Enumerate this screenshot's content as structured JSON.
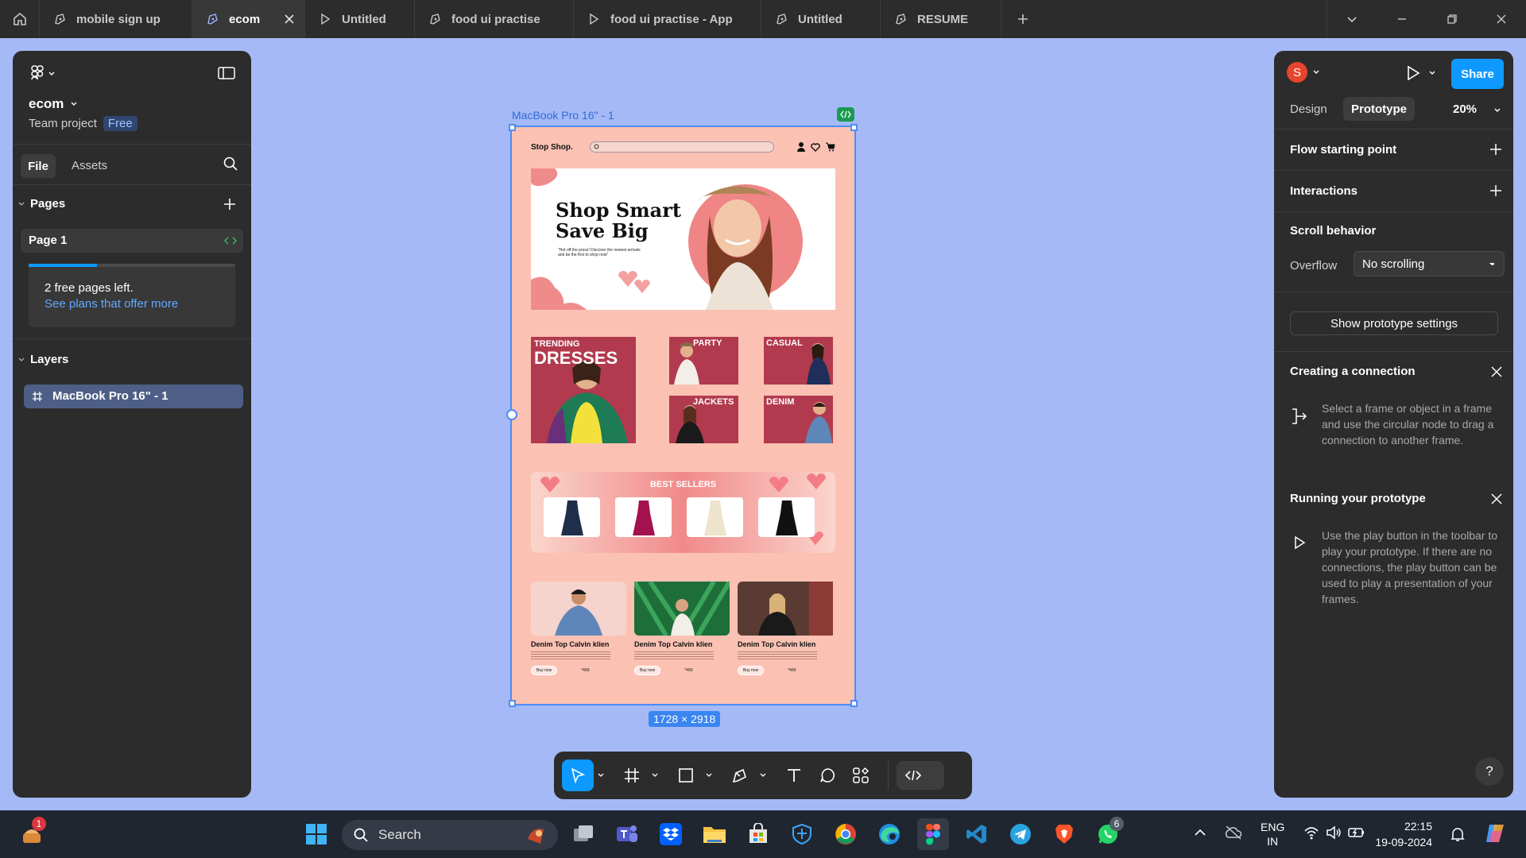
{
  "tabs": [
    {
      "label": "mobile sign up",
      "icon": "figma-file-icon"
    },
    {
      "label": "ecom",
      "icon": "figma-file-icon",
      "active": true
    },
    {
      "label": "Untitled",
      "icon": "play-icon"
    },
    {
      "label": "food ui practise",
      "icon": "figma-file-icon"
    },
    {
      "label": "food ui practise - App",
      "icon": "play-icon"
    },
    {
      "label": "Untitled",
      "icon": "figma-file-icon"
    },
    {
      "label": "RESUME",
      "icon": "figma-file-icon"
    }
  ],
  "left": {
    "project": "ecom",
    "team": "Team project",
    "plan_badge": "Free",
    "tab_file": "File",
    "tab_assets": "Assets",
    "pages_title": "Pages",
    "page1": "Page 1",
    "free_pages": "2 free pages left.",
    "plans_link": "See plans that offer more",
    "free_pages_progress": 0.33,
    "layers_title": "Layers",
    "layer1": "MacBook Pro 16\" - 1"
  },
  "canvas": {
    "frame_label": "MacBook Pro 16\" - 1",
    "size_badge": "1728 × 2918"
  },
  "design": {
    "logo": "Stop Shop.",
    "hero_line1": "Shop Smart",
    "hero_line2": "Save Big",
    "hero_sub": "\"Hot off the press! Discover the newest arrivals and be the first to shop now\"",
    "trending": "TRENDING",
    "dresses": "DRESSES",
    "cat_party": "PARTY",
    "cat_casual": "CASUAL",
    "cat_jackets": "JACKETS",
    "cat_denim": "DENIM",
    "best_sellers": "BEST SELLERS",
    "product_name": "Denim Top Calvin klien",
    "buy_now": "Buy now",
    "price": "*499"
  },
  "right": {
    "avatar_letter": "S",
    "share": "Share",
    "tab_design": "Design",
    "tab_prototype": "Prototype",
    "zoom": "20%",
    "flow": "Flow starting point",
    "interactions": "Interactions",
    "scroll": "Scroll behavior",
    "overflow_label": "Overflow",
    "overflow_value": "No scrolling",
    "show_settings": "Show prototype settings",
    "creating_title": "Creating a connection",
    "creating_text": "Select a frame or object in a frame and use the circular node to drag a connection to another frame.",
    "running_title": "Running your prototype",
    "running_text": "Use the play button in the toolbar to play your prototype. If there are no connections, the play button can be used to play a presentation of your frames.",
    "help": "?"
  },
  "taskbar": {
    "search": "Search",
    "lang1": "ENG",
    "lang2": "IN",
    "time": "22:15",
    "date": "19-09-2024",
    "notif_badge": "1",
    "whatsapp_badge": "6"
  },
  "colors": {
    "accent": "#0d99ff",
    "canvas": "#a5b9f6",
    "panel": "#2c2c2c",
    "selection": "#4d8cf5",
    "design_pink": "#fbc2b4",
    "design_maroon": "#b23a4e"
  }
}
